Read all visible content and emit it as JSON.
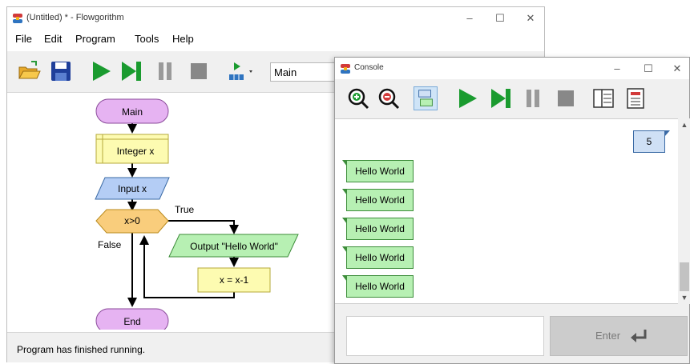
{
  "main_window": {
    "title": "(Untitled) * - Flowgorithm",
    "controls": {
      "minimize": "–",
      "maximize": "☐",
      "close": "✕"
    },
    "menu": [
      "File",
      "Edit",
      "Program",
      "Tools",
      "Help"
    ],
    "toolbar": {
      "icons": [
        "open-folder",
        "save",
        "run",
        "step",
        "pause",
        "stop",
        "layout-dropdown"
      ],
      "function_select": "Main"
    },
    "flowchart": {
      "start": "Main",
      "declare": "Integer x",
      "input": "Input x",
      "condition": "x>0",
      "true_label": "True",
      "false_label": "False",
      "output": "Output \"Hello World\"",
      "assign": "x = x-1",
      "end": "End"
    },
    "status": "Program has finished running."
  },
  "console_window": {
    "title": "Console",
    "controls": {
      "minimize": "–",
      "maximize": "☐",
      "close": "✕"
    },
    "toolbar_icons": [
      "zoom-in",
      "zoom-out",
      "chat-view",
      "run",
      "step",
      "pause",
      "stop",
      "layout-split",
      "layout-full"
    ],
    "input_echo": "5",
    "outputs": [
      "Hello World",
      "Hello World",
      "Hello World",
      "Hello World",
      "Hello World"
    ],
    "input_value": "",
    "enter_label": "Enter"
  },
  "colors": {
    "run_green": "#1a9b2f",
    "terminal_purple": "#e6b3f2",
    "process_yellow": "#fdfbb1",
    "io_blue": "#b4cdf5",
    "decision_orange": "#f9cd7c",
    "output_green": "#b7f0b3",
    "stop_gray": "#888888"
  }
}
